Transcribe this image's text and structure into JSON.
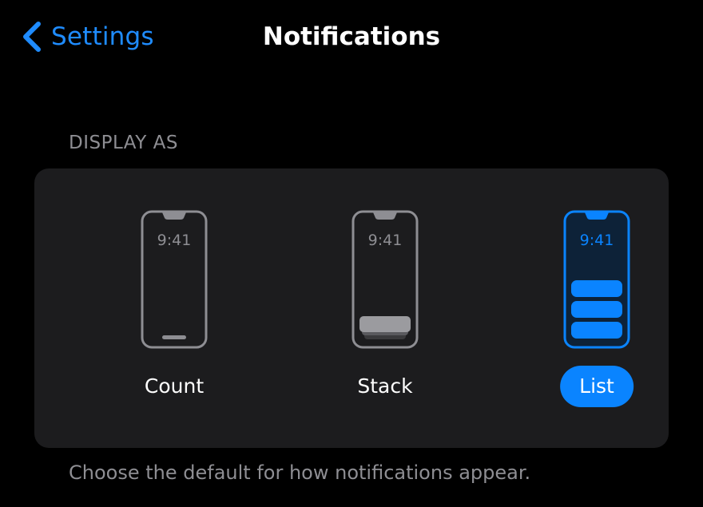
{
  "nav": {
    "back_label": "Settings",
    "title": "Notifications"
  },
  "section": {
    "header": "DISPLAY AS",
    "footer": "Choose the default for how notifications appear."
  },
  "options": [
    {
      "label": "Count",
      "time": "9:41",
      "selected": false
    },
    {
      "label": "Stack",
      "time": "9:41",
      "selected": false
    },
    {
      "label": "List",
      "time": "9:41",
      "selected": true
    }
  ],
  "colors": {
    "accent": "#0a84ff",
    "link": "#1f8cff",
    "background": "#000000",
    "card": "#1c1c1e",
    "secondary_text": "#8e8e93",
    "phone_outline": "#8e8e93"
  },
  "icons": {
    "back": "chevron-left-icon"
  }
}
